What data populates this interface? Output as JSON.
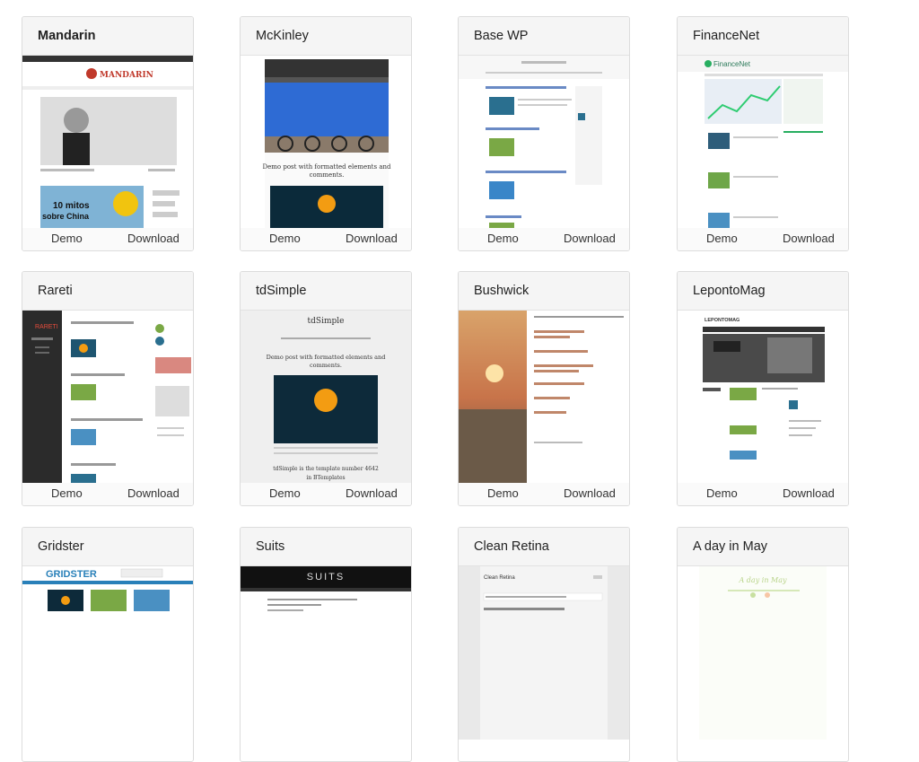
{
  "link_labels": {
    "demo": "Demo",
    "download": "Download"
  },
  "themes": [
    {
      "title": "Mandarin",
      "thumb_text": [
        "MANDARIN",
        "10 mitos",
        "sobre China"
      ]
    },
    {
      "title": "McKinley",
      "thumb_text": [
        "Demo post with formatted elements and",
        "comments."
      ]
    },
    {
      "title": "Base WP",
      "thumb_text": []
    },
    {
      "title": "FinanceNet",
      "thumb_text": [
        "FinanceNet"
      ]
    },
    {
      "title": "Rareti",
      "thumb_text": [
        "RARETI"
      ]
    },
    {
      "title": "tdSimple",
      "thumb_text": [
        "tdSimple",
        "Demo post with formatted elements and",
        "comments.",
        "tdSimple is the template number 4642",
        "in BTemplates"
      ]
    },
    {
      "title": "Bushwick",
      "thumb_text": []
    },
    {
      "title": "LepontoMag",
      "thumb_text": [
        "LEPONTOMAG"
      ]
    },
    {
      "title": "Gridster",
      "thumb_text": [
        "GRIDSTER"
      ]
    },
    {
      "title": "Suits",
      "thumb_text": [
        "SUITS"
      ]
    },
    {
      "title": "Clean Retina",
      "thumb_text": [
        "Clean Retina"
      ]
    },
    {
      "title": "A day in May",
      "thumb_text": [
        "A day in May"
      ]
    }
  ]
}
